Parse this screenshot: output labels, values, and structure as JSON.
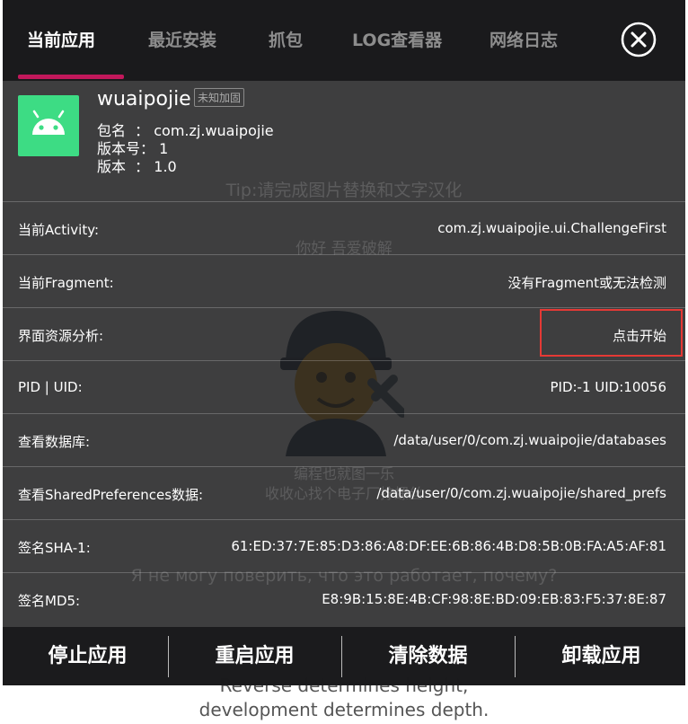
{
  "background": {
    "footer_line1": "Reverse determines height,",
    "footer_line2": "development determines depth.",
    "greeting": "你好 吾爱破解",
    "tip": "Tip:请完成图片替换和文字汉化",
    "mascot_line1": "编程也就图一乐",
    "mascot_line2": "收收心找个电子厂拧螺丝",
    "russian": "Я не могу поверить, что это работает, почему?"
  },
  "tabs": [
    {
      "label": "当前应用",
      "active": true
    },
    {
      "label": "最近安装",
      "active": false
    },
    {
      "label": "抓包",
      "active": false
    },
    {
      "label": "LOG查看器",
      "active": false
    },
    {
      "label": "网络日志",
      "active": false
    }
  ],
  "close_icon": "close-circle-icon",
  "app": {
    "icon": "android-icon",
    "icon_color": "#3ddc84",
    "name": "wuaipojie",
    "badge": "未知加固",
    "package_line": "包名  ： com.zj.wuaipojie",
    "version_code_line": "版本号： 1",
    "version_line": "版本  ： 1.0"
  },
  "rows": [
    {
      "label": "当前Activity:",
      "value": "com.zj.wuaipojie.ui.ChallengeFirst"
    },
    {
      "label": "当前Fragment:",
      "value": "没有Fragment或无法检测"
    },
    {
      "label": "界面资源分析:",
      "value": "点击开始"
    },
    {
      "label": "PID  |   UID:",
      "value": "PID:-1      UID:10056"
    },
    {
      "label": "查看数据库:",
      "value": "/data/user/0/com.zj.wuaipojie/databases"
    },
    {
      "label": "查看SharedPreferences数据:",
      "value": "/data/user/0/com.zj.wuaipojie/shared_prefs"
    },
    {
      "label": "签名SHA-1:",
      "value": "61:ED:37:7E:85:D3:86:A8:DF:EE:6B:86:4B:D8:5B:0B:FA:A5:AF:81"
    },
    {
      "label": "签名MD5:",
      "value": "E8:9B:15:8E:4B:CF:98:8E:BD:09:EB:83:F5:37:8E:87"
    }
  ],
  "actions": {
    "stop": "停止应用",
    "restart": "重启应用",
    "clear": "清除数据",
    "uninstall": "卸载应用"
  },
  "colors": {
    "tab_indicator": "#c2185b",
    "highlight": "#e53935"
  }
}
